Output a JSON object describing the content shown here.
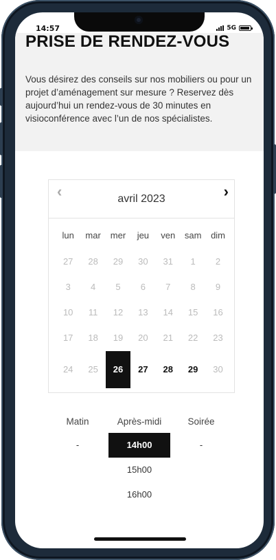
{
  "status_bar": {
    "time": "14:57",
    "network": "5G",
    "battery_level": 0.9
  },
  "hero": {
    "title": "PRISE DE RENDEZ-VOUS",
    "description": "Vous désirez des conseils sur nos mobiliers ou pour un projet d’aménagement sur mesure ? Reservez dès aujourd’hui un rendez-vous de 30 minutes en visioconférence avec l’un de nos spécialistes."
  },
  "calendar": {
    "month_label": "avril 2023",
    "prev_icon": "‹",
    "next_icon": "›",
    "weekdays": [
      "lun",
      "mar",
      "mer",
      "jeu",
      "ven",
      "sam",
      "dim"
    ],
    "weeks": [
      [
        {
          "d": "27",
          "s": "disabled"
        },
        {
          "d": "28",
          "s": "disabled"
        },
        {
          "d": "29",
          "s": "disabled"
        },
        {
          "d": "30",
          "s": "disabled"
        },
        {
          "d": "31",
          "s": "disabled"
        },
        {
          "d": "1",
          "s": "disabled"
        },
        {
          "d": "2",
          "s": "disabled"
        }
      ],
      [
        {
          "d": "3",
          "s": "disabled"
        },
        {
          "d": "4",
          "s": "disabled"
        },
        {
          "d": "5",
          "s": "disabled"
        },
        {
          "d": "6",
          "s": "disabled"
        },
        {
          "d": "7",
          "s": "disabled"
        },
        {
          "d": "8",
          "s": "disabled"
        },
        {
          "d": "9",
          "s": "disabled"
        }
      ],
      [
        {
          "d": "10",
          "s": "disabled"
        },
        {
          "d": "11",
          "s": "disabled"
        },
        {
          "d": "12",
          "s": "disabled"
        },
        {
          "d": "13",
          "s": "disabled"
        },
        {
          "d": "14",
          "s": "disabled"
        },
        {
          "d": "15",
          "s": "disabled"
        },
        {
          "d": "16",
          "s": "disabled"
        }
      ],
      [
        {
          "d": "17",
          "s": "disabled"
        },
        {
          "d": "18",
          "s": "disabled"
        },
        {
          "d": "19",
          "s": "disabled"
        },
        {
          "d": "20",
          "s": "disabled"
        },
        {
          "d": "21",
          "s": "disabled"
        },
        {
          "d": "22",
          "s": "disabled"
        },
        {
          "d": "23",
          "s": "disabled"
        }
      ],
      [
        {
          "d": "24",
          "s": "disabled"
        },
        {
          "d": "25",
          "s": "disabled"
        },
        {
          "d": "26",
          "s": "selected"
        },
        {
          "d": "27",
          "s": "available"
        },
        {
          "d": "28",
          "s": "available"
        },
        {
          "d": "29",
          "s": "available"
        },
        {
          "d": "30",
          "s": "disabled"
        }
      ]
    ]
  },
  "slots": {
    "columns": [
      {
        "label": "Matin",
        "times": [
          {
            "t": "-",
            "s": "empty"
          }
        ]
      },
      {
        "label": "Après-midi",
        "times": [
          {
            "t": "14h00",
            "s": "selected"
          },
          {
            "t": "15h00",
            "s": "available"
          },
          {
            "t": "16h00",
            "s": "available"
          }
        ]
      },
      {
        "label": "Soirée",
        "times": [
          {
            "t": "-",
            "s": "empty"
          }
        ]
      }
    ]
  },
  "colors": {
    "accent": "#111111",
    "hero_bg": "#f2f2f2",
    "disabled_text": "#bbbbbb"
  }
}
